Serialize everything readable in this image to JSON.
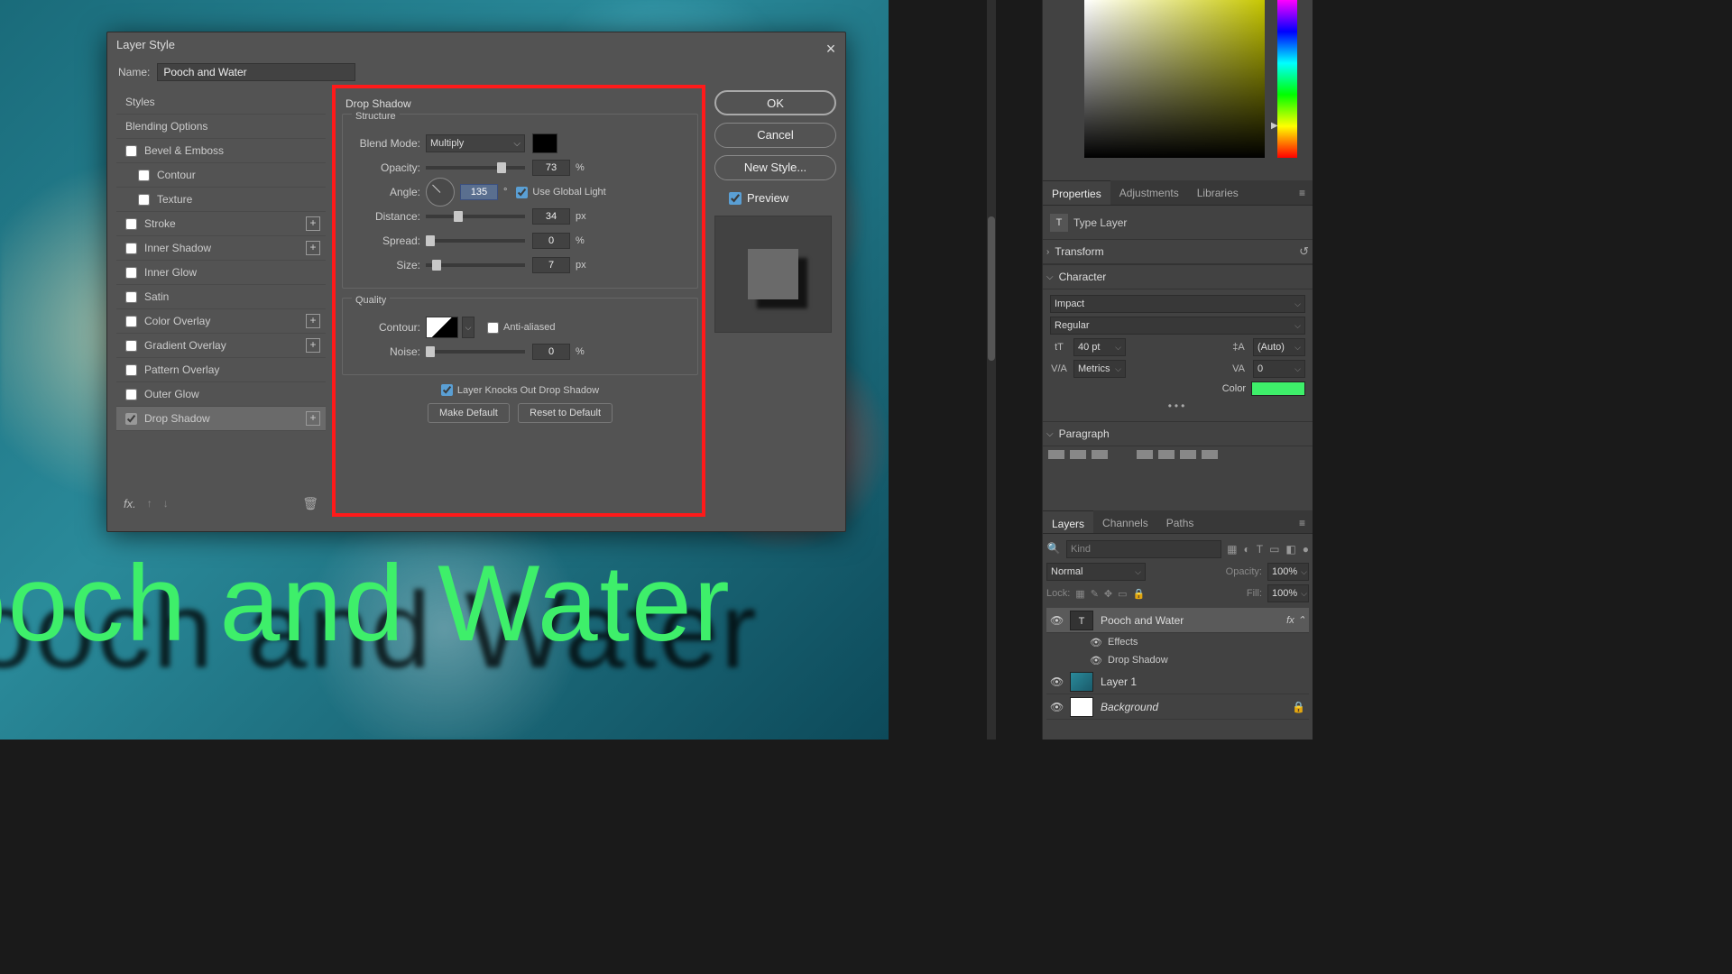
{
  "dialog": {
    "title": "Layer Style",
    "name_label": "Name:",
    "name_value": "Pooch and Water",
    "ok": "OK",
    "cancel": "Cancel",
    "new_style": "New Style...",
    "preview": "Preview"
  },
  "styles_list": {
    "header": "Styles",
    "blending": "Blending Options",
    "bevel": "Bevel & Emboss",
    "contour": "Contour",
    "texture": "Texture",
    "stroke": "Stroke",
    "inner_shadow": "Inner Shadow",
    "inner_glow": "Inner Glow",
    "satin": "Satin",
    "color_overlay": "Color Overlay",
    "gradient_overlay": "Gradient Overlay",
    "pattern_overlay": "Pattern Overlay",
    "outer_glow": "Outer Glow",
    "drop_shadow": "Drop Shadow"
  },
  "drop_shadow": {
    "title": "Drop Shadow",
    "structure": "Structure",
    "blend_mode_label": "Blend Mode:",
    "blend_mode_value": "Multiply",
    "opacity_label": "Opacity:",
    "opacity_value": "73",
    "angle_label": "Angle:",
    "angle_value": "135",
    "angle_unit": "°",
    "use_global": "Use Global Light",
    "distance_label": "Distance:",
    "distance_value": "34",
    "px": "px",
    "spread_label": "Spread:",
    "spread_value": "0",
    "size_label": "Size:",
    "size_value": "7",
    "quality": "Quality",
    "contour_label": "Contour:",
    "anti_aliased": "Anti-aliased",
    "noise_label": "Noise:",
    "noise_value": "0",
    "pct": "%",
    "knock_out": "Layer Knocks Out Drop Shadow",
    "make_default": "Make Default",
    "reset_default": "Reset to Default"
  },
  "overlay_text": "ooch and Water",
  "properties": {
    "tab_properties": "Properties",
    "tab_adjustments": "Adjustments",
    "tab_libraries": "Libraries",
    "type_layer": "Type Layer",
    "transform": "Transform",
    "character": "Character",
    "font": "Impact",
    "weight": "Regular",
    "size": "40 pt",
    "auto": "(Auto)",
    "metrics": "Metrics",
    "zero": "0",
    "color_label": "Color",
    "paragraph": "Paragraph"
  },
  "layers": {
    "tab_layers": "Layers",
    "tab_channels": "Channels",
    "tab_paths": "Paths",
    "kind": "Kind",
    "normal": "Normal",
    "opacity": "Opacity:",
    "opacity_val": "100%",
    "lock": "Lock:",
    "fill": "Fill:",
    "fill_val": "100%",
    "layer_text": "Pooch and Water",
    "effects": "Effects",
    "ds": "Drop Shadow",
    "layer1": "Layer 1",
    "background": "Background"
  }
}
